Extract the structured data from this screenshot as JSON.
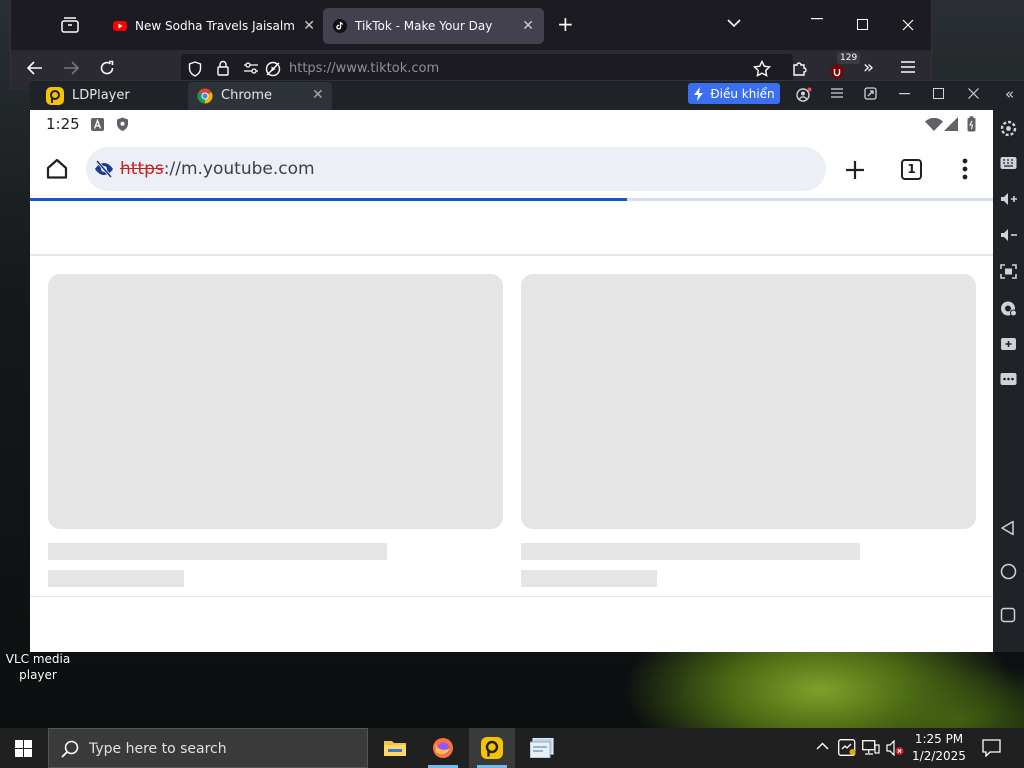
{
  "desktop": {
    "icon_label_line1": "VLC media",
    "icon_label_line2": "player"
  },
  "firefox": {
    "tabs": [
      {
        "label": "New Sodha Travels Jaisalmer To"
      },
      {
        "label": "TikTok - Make Your Day"
      }
    ],
    "url": "https://www.tiktok.com",
    "extension_badge": "129"
  },
  "ldplayer": {
    "app_title": "LDPlayer",
    "tab_title": "Chrome",
    "control_label": "Điều khiển"
  },
  "android": {
    "status_time": "1:25",
    "omnibox": {
      "scheme": "https",
      "rest": "://m.youtube.com"
    },
    "tab_count": "1",
    "load_progress": 0.62
  },
  "taskbar": {
    "search_placeholder": "Type here to search",
    "time": "1:25 PM",
    "date": "1/2/2025"
  },
  "colors": {
    "ld_accent": "#3b6ff2",
    "progress": "#1a56c8",
    "https_strike": "#c5221f",
    "youtube_red": "#ff0000"
  }
}
